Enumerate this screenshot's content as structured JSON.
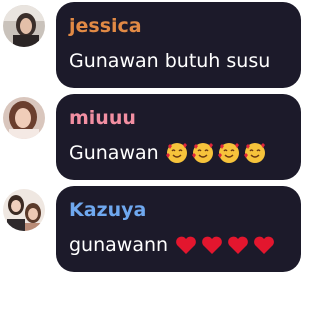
{
  "colors": {
    "bubble_bg": "#1c1a2a",
    "message_text": "#ffffff",
    "name_jessica": "#e28a45",
    "name_miuuu": "#f28fa2",
    "name_kazuya": "#6fa8ef"
  },
  "messages": [
    {
      "username": "jessica",
      "text": "Gunawan butuh susu",
      "avatar_icon": "user-photo-avatar",
      "emojis": ""
    },
    {
      "username": "miuuu",
      "text": "Gunawan",
      "avatar_icon": "user-photo-avatar",
      "emojis": "🥰🥰🥰🥰"
    },
    {
      "username": "Kazuya",
      "text": "gunawann",
      "avatar_icon": "user-photo-avatar",
      "emojis": "❤️❤️❤️❤️"
    }
  ]
}
